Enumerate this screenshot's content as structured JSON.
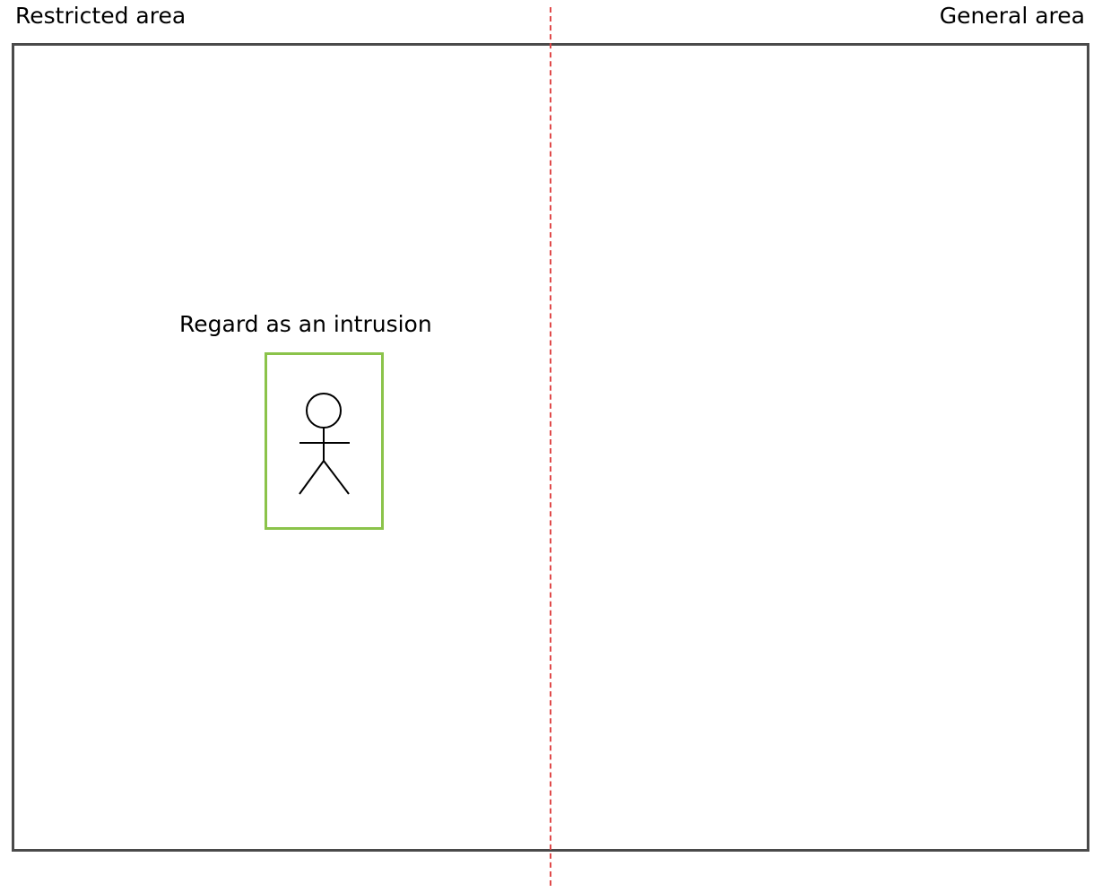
{
  "areas": {
    "restricted_label": "Restricted area",
    "general_label": "General area"
  },
  "detection": {
    "caption": "Regard as an intrusion",
    "box_color": "#8bc34a",
    "icon": "person-icon"
  },
  "boundary": {
    "color": "#e04a4a",
    "style": "dashed"
  },
  "frame": {
    "color": "#4a4a4a"
  }
}
